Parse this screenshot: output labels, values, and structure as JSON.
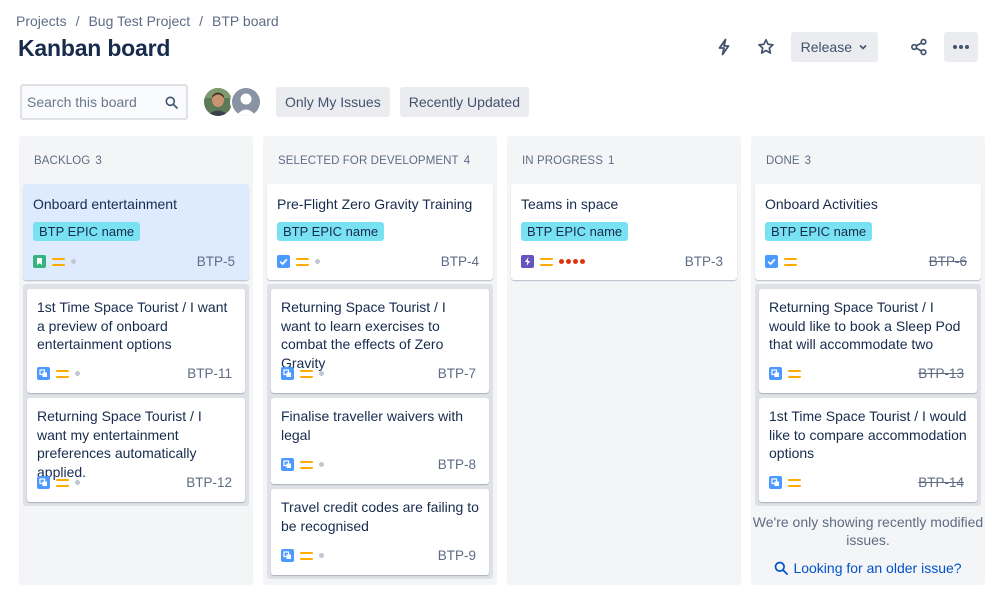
{
  "breadcrumb": {
    "projects": "Projects",
    "project": "Bug Test Project",
    "board": "BTP board",
    "separator": "/"
  },
  "page": {
    "title": "Kanban board"
  },
  "actions": {
    "release_label": "Release"
  },
  "toolbar": {
    "search_placeholder": "Search this board",
    "filters": [
      "Only My Issues",
      "Recently Updated"
    ]
  },
  "columns": [
    {
      "name": "BACKLOG",
      "count": "3",
      "epic": {
        "title": "Onboard entertainment",
        "epic_label": "BTP EPIC name",
        "key": "BTP-5",
        "type_icon": "story-icon",
        "priority_icon": "priority-medium-icon"
      },
      "cards": [
        {
          "title": "1st Time Space Tourist / I want a preview of onboard entertainment options",
          "key": "BTP-11",
          "type_icon": "subtask-icon",
          "priority_icon": "priority-medium-icon"
        },
        {
          "title": "Returning Space Tourist / I want my entertainment preferences automatically applied.",
          "key": "BTP-12",
          "type_icon": "subtask-icon",
          "priority_icon": "priority-medium-icon"
        }
      ]
    },
    {
      "name": "SELECTED FOR DEVELOPMENT",
      "count": "4",
      "epic": {
        "title": "Pre-Flight Zero Gravity Training",
        "epic_label": "BTP EPIC name",
        "key": "BTP-4",
        "type_icon": "task-icon",
        "priority_icon": "priority-medium-icon"
      },
      "cards": [
        {
          "title": "Returning Space Tourist / I want to learn exercises to combat the effects of Zero Gravity",
          "key": "BTP-7",
          "type_icon": "subtask-icon",
          "priority_icon": "priority-medium-icon"
        },
        {
          "title": "Finalise traveller waivers with legal",
          "key": "BTP-8",
          "type_icon": "subtask-icon",
          "priority_icon": "priority-medium-icon"
        },
        {
          "title": "Travel credit codes are failing to be recognised",
          "key": "BTP-9",
          "type_icon": "subtask-icon",
          "priority_icon": "priority-medium-icon"
        }
      ]
    },
    {
      "name": "IN PROGRESS",
      "count": "1",
      "epic": {
        "title": "Teams in space",
        "epic_label": "BTP EPIC name",
        "key": "BTP-3",
        "type_icon": "epic-icon",
        "priority_icon": "priority-medium-icon"
      },
      "cards": []
    },
    {
      "name": "DONE",
      "count": "3",
      "epic": {
        "title": "Onboard Activities",
        "epic_label": "BTP EPIC name",
        "key": "BTP-6",
        "type_icon": "task-icon",
        "priority_icon": "priority-medium-icon"
      },
      "cards": [
        {
          "title": "Returning Space Tourist / I would like to book a Sleep Pod that will accommodate two adults and",
          "key": "BTP-13",
          "type_icon": "subtask-icon",
          "priority_icon": "priority-medium-icon"
        },
        {
          "title": "1st Time Space Tourist / I would like to compare accommodation options",
          "key": "BTP-14",
          "type_icon": "subtask-icon",
          "priority_icon": "priority-medium-icon"
        }
      ],
      "note": "We're only showing recently modified issues.",
      "older_link": "Looking for an older issue?"
    }
  ],
  "colors": {
    "epic_label_bg": "#79e2f2",
    "story_green": "#36b37e",
    "task_blue": "#4c9aff",
    "epic_purple": "#6554c0",
    "priority_orange": "#ffab00",
    "estimate_red": "#de350b",
    "link_blue": "#0052cc",
    "highlight_bg": "#deebff"
  }
}
